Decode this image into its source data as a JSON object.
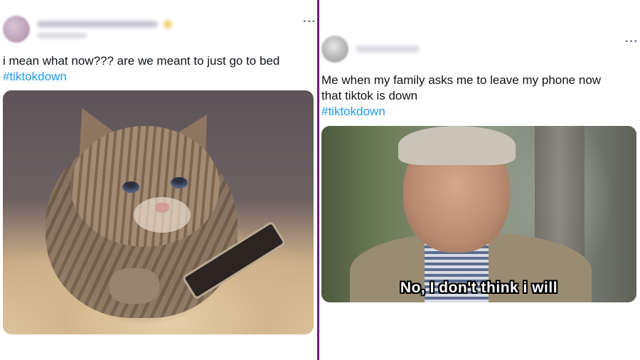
{
  "tweets": {
    "left": {
      "text_line1": "i mean what now??? are we meant to just go to bed",
      "hashtag": "#tiktokdown",
      "more_label": "···",
      "media_icon": "crying-kitten-with-phone-image"
    },
    "right": {
      "text_line1": "Me when my family asks me to leave my phone now",
      "text_line2": "that tiktok is down",
      "hashtag": "#tiktokdown",
      "more_label": "···",
      "media_caption": "No, I don't think i will",
      "media_icon": "old-man-meme-image"
    }
  },
  "colors": {
    "hashtag": "#1d9bf0",
    "divider": "#6a1f7a",
    "text": "#0f1419"
  }
}
